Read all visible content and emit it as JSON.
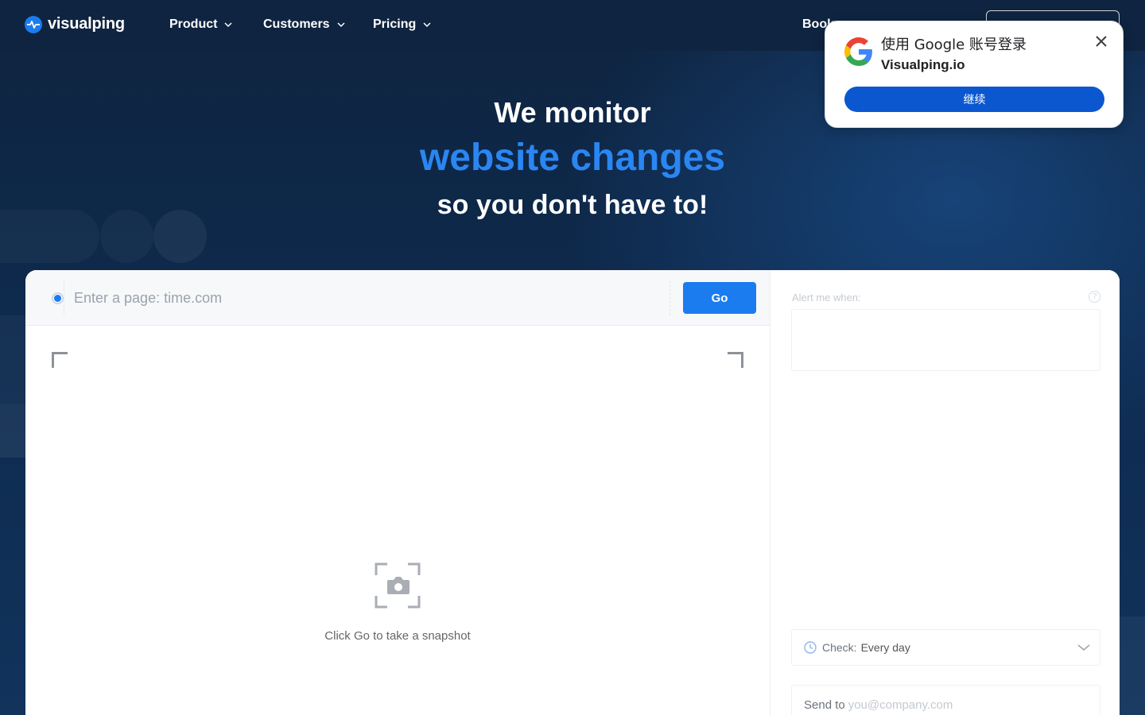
{
  "nav": {
    "logo_text": "visualping",
    "items": [
      {
        "label": "Product"
      },
      {
        "label": "Customers"
      },
      {
        "label": "Pricing"
      }
    ],
    "book_label": "Book"
  },
  "hero": {
    "line1": "We monitor",
    "line2": "website changes",
    "line3": "so you don't have to!"
  },
  "monitor": {
    "url_placeholder": "Enter a page: time.com",
    "go_label": "Go",
    "snapshot_hint": "Click Go to take a snapshot",
    "alert_label": "Alert me when:",
    "check_label": "Check:",
    "check_value": "Every day",
    "send_label": "Send to",
    "send_placeholder": "you@company.com"
  },
  "google_popup": {
    "title": "使用 Google 账号登录",
    "site": "Visualping.io",
    "continue_label": "继续"
  },
  "colors": {
    "accent": "#1b7cf0",
    "hero_highlight": "#2a86f2",
    "background": "#0f2440",
    "google_button": "#0b57d0"
  }
}
